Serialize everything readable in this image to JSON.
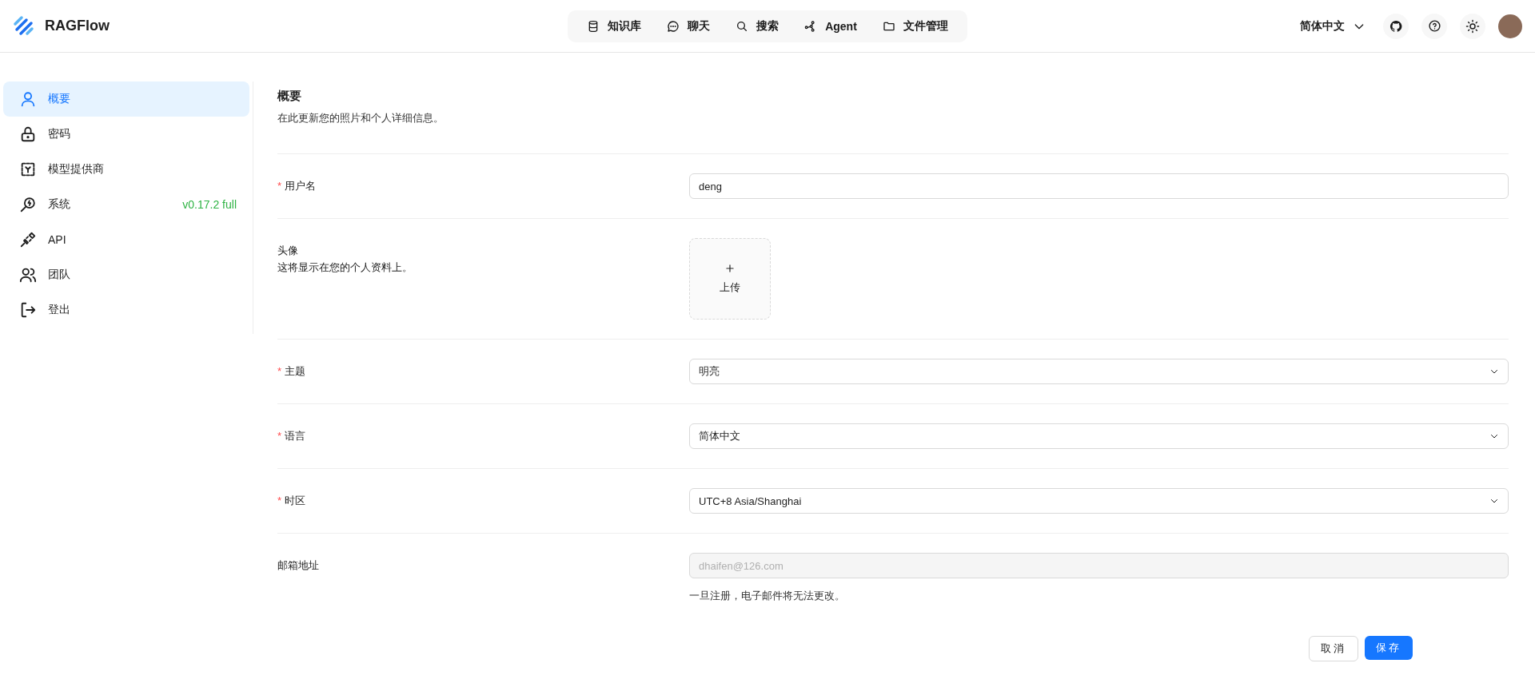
{
  "app": {
    "name": "RAGFlow"
  },
  "nav": [
    {
      "label": "知识库"
    },
    {
      "label": "聊天"
    },
    {
      "label": "搜索"
    },
    {
      "label": "Agent"
    },
    {
      "label": "文件管理"
    }
  ],
  "header": {
    "language": "简体中文"
  },
  "sidebar": {
    "items": [
      {
        "label": "概要",
        "selected": true
      },
      {
        "label": "密码",
        "selected": false
      },
      {
        "label": "模型提供商",
        "selected": false
      },
      {
        "label": "系统",
        "selected": false,
        "badge": "v0.17.2 full"
      },
      {
        "label": "API",
        "selected": false
      },
      {
        "label": "团队",
        "selected": false
      },
      {
        "label": "登出",
        "selected": false
      }
    ]
  },
  "form": {
    "title": "概要",
    "subtitle": "在此更新您的照片和个人详细信息。",
    "fields": [
      {
        "kind": "text",
        "label": "用户名",
        "required_mark": "*",
        "disabled": false,
        "value": "deng"
      },
      {
        "kind": "upload",
        "label": "头像",
        "disabled": false,
        "description": "这将显示在您的个人资料上。",
        "button": "上传"
      },
      {
        "kind": "select",
        "label": "主题",
        "required_mark": "*",
        "disabled": false,
        "value": "明亮"
      },
      {
        "kind": "select",
        "label": "语言",
        "required_mark": "*",
        "disabled": false,
        "value": "简体中文"
      },
      {
        "kind": "select",
        "label": "时区",
        "required_mark": "*",
        "disabled": false,
        "value": "UTC+8 Asia/Shanghai"
      },
      {
        "kind": "text",
        "label": "邮箱地址",
        "disabled": true,
        "value": "dhaifen@126.com",
        "help": "一旦注册，电子邮件将无法更改。"
      }
    ],
    "buttons": {
      "cancel": "取消",
      "save": "保存"
    }
  }
}
